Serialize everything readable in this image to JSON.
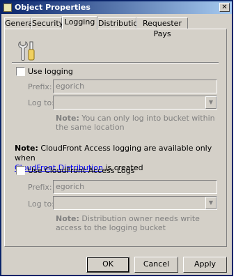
{
  "window": {
    "title": "Object Properties",
    "close_glyph": "✕"
  },
  "tabs": [
    {
      "label": "General",
      "active": false
    },
    {
      "label": "Security",
      "active": false
    },
    {
      "label": "Logging",
      "active": true
    },
    {
      "label": "Distribution",
      "active": false
    },
    {
      "label": "Requester Pays",
      "active": false
    }
  ],
  "logging": {
    "icon": "tools-icon",
    "use_logging_label": "Use logging",
    "use_logging_checked": false,
    "prefix_label": "Prefix:",
    "prefix_value": "egorich",
    "log_to_label": "Log to:",
    "log_to_value": "",
    "note_label": "Note:",
    "note_text": "You can only log into bucket within the same location"
  },
  "cloudfront": {
    "note_label": "Note:",
    "note_text_before": "CloudFront Access logging are available only when",
    "link_text": "CloudFront Distribution",
    "note_text_after": "is created",
    "use_label": "Use CloudFront Access Logs",
    "use_checked": false,
    "prefix_label": "Prefix:",
    "prefix_value": "egorich",
    "log_to_label": "Log to:",
    "log_to_value": "",
    "note2_label": "Note:",
    "note2_text": "Distribution owner needs write access to the logging bucket"
  },
  "buttons": {
    "ok": "OK",
    "cancel": "Cancel",
    "apply": "Apply"
  },
  "colors": {
    "title_start": "#0a246a",
    "title_end": "#a6caf0",
    "face": "#d4d0c8",
    "link": "#0000ee"
  }
}
